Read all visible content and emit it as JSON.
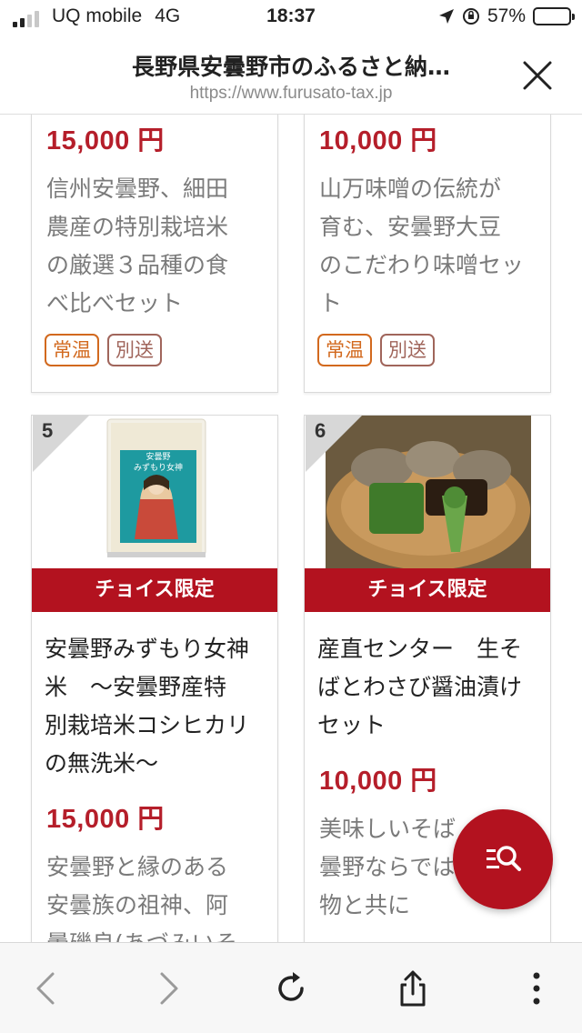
{
  "status_bar": {
    "carrier": "UQ mobile",
    "network": "4G",
    "time": "18:37",
    "battery": "57%",
    "battery_level": 0.57
  },
  "browser": {
    "page_title": "長野県安曇野市のふるさと納…",
    "url": "https://www.furusato-tax.jp"
  },
  "products": {
    "top_left": {
      "price": "15,000 円",
      "description": [
        "信州安曇野、細田",
        "農産の特別栽培米",
        "の厳選３品種の食",
        "べ比べセット"
      ],
      "tags": [
        "常温",
        "別送"
      ]
    },
    "top_right": {
      "price": "10,000 円",
      "description": [
        "山万味噌の伝統が",
        "育む、安曇野大豆",
        "のこだわり味噌セッ",
        "ト"
      ],
      "tags": [
        "常温",
        "別送"
      ]
    },
    "bottom_left": {
      "rank": "5",
      "badge": "チョイス限定",
      "package_text": [
        "安曇野",
        "みずもり女神"
      ],
      "name": [
        "安曇野みずもり女神",
        "米　～安曇野産特",
        "別栽培米コシヒカリ",
        "の無洗米～"
      ],
      "price": "15,000 円",
      "description": [
        "安曇野と縁のある",
        "安曇族の祖神、阿",
        "曇磯良(あづみいそ"
      ]
    },
    "bottom_right": {
      "rank": "6",
      "badge": "チョイス限定",
      "name": [
        "産直センター　生そ",
        "ばとわさび醤油漬け",
        "セット"
      ],
      "price": "10,000 円",
      "description": [
        "美味しいそば",
        "曇野ならでは",
        "物と共に"
      ]
    }
  },
  "colors": {
    "accent": "#b3121f",
    "price": "#b51e2a",
    "tag_normal": "#d2691e",
    "tag_separate": "#a0655b"
  },
  "icons": {
    "close": "close-icon",
    "search": "search-list-icon",
    "back": "chevron-left-icon",
    "forward": "chevron-right-icon",
    "reload": "reload-icon",
    "share": "share-icon",
    "more": "more-vertical-icon"
  }
}
